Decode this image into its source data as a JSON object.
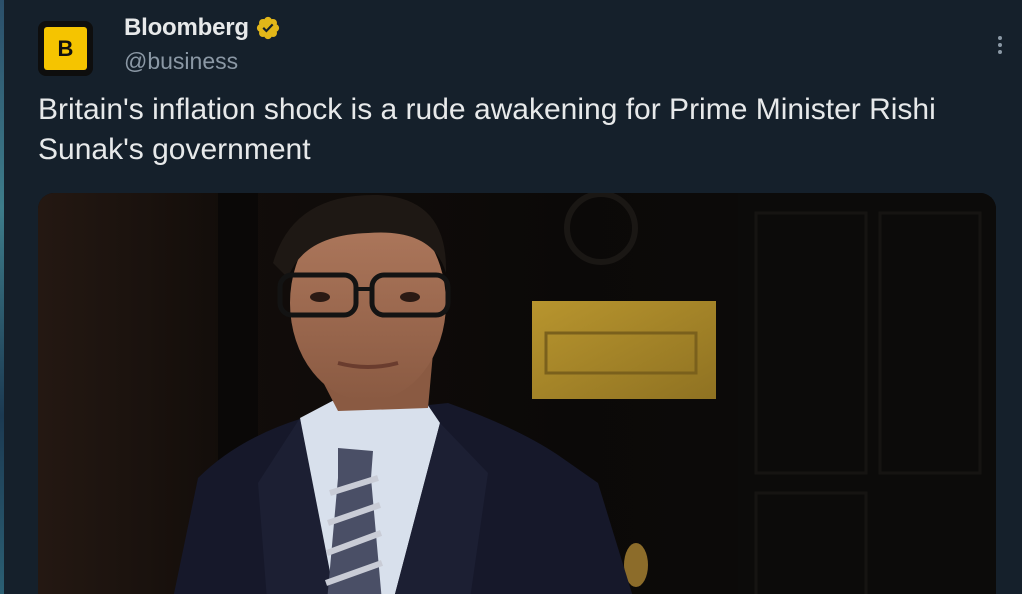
{
  "tweet": {
    "author": {
      "display_name": "Bloomberg",
      "handle": "@business",
      "avatar_letter": "B",
      "verified_icon": "verified-gold-badge-icon",
      "brand_color": "#f5c400"
    },
    "text": "Britain's inflation shock is a rude awakening for Prime Minister Rishi Sunak's government",
    "more_icon": "more-vertical-icon",
    "media_icon": "photo"
  },
  "theme": {
    "background": "#15202b",
    "text_primary": "#e7e9ea",
    "text_secondary": "#8b98a5",
    "verified": "#e2b719"
  }
}
